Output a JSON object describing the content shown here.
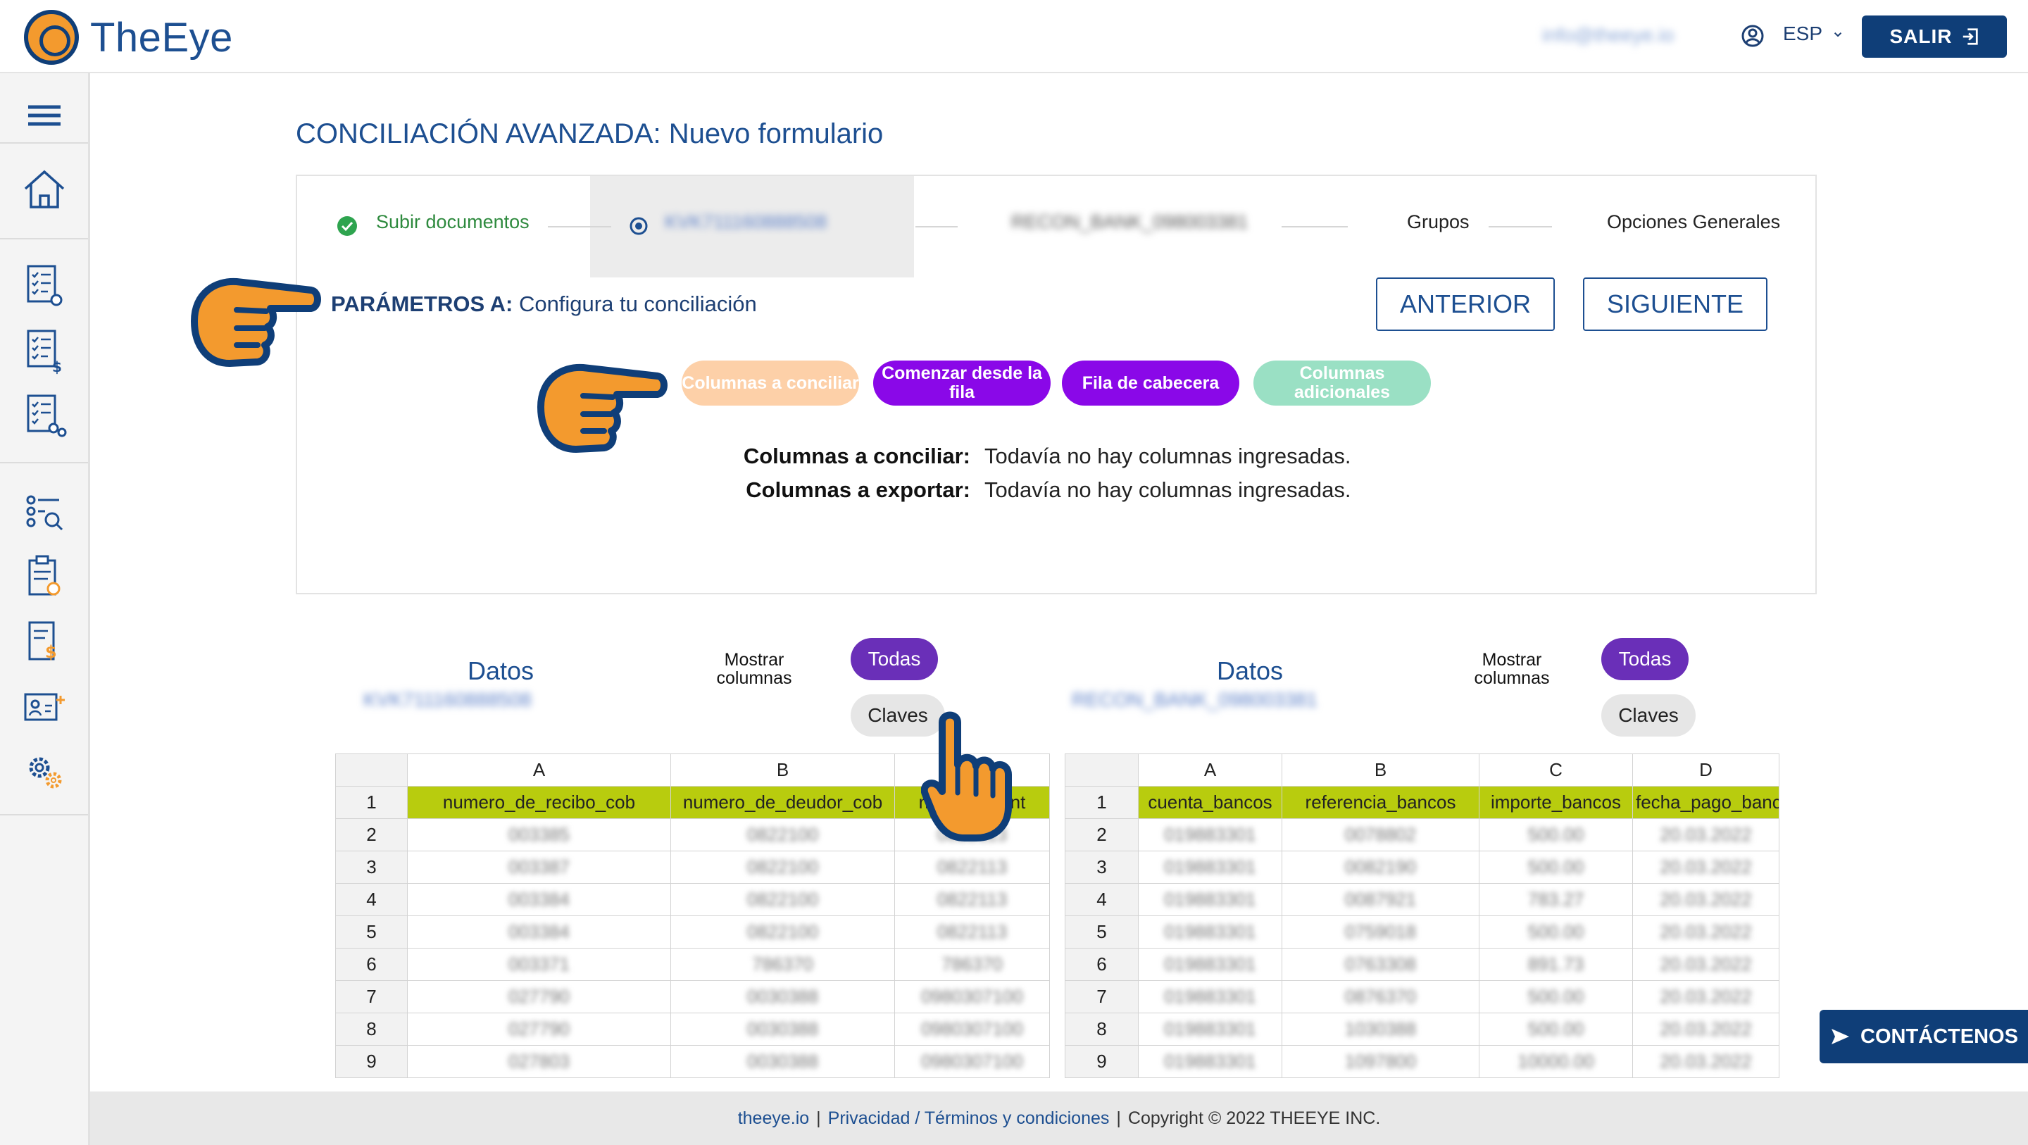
{
  "app": {
    "name": "TheEye",
    "user_email": "info@theeye.io",
    "language": "ESP",
    "logout_label": "SALIR"
  },
  "page": {
    "title": "CONCILIACIÓN AVANZADA:  Nuevo formulario"
  },
  "steps": [
    {
      "label": "Subir documentos",
      "state": "done"
    },
    {
      "label": "KVK711160888508",
      "state": "active"
    },
    {
      "label": "RECON_BANK_098003381",
      "state": "pending"
    },
    {
      "label": "Grupos",
      "state": "pending"
    },
    {
      "label": "Opciones Generales",
      "state": "pending"
    }
  ],
  "params": {
    "prefix": "PARÁMETROS A:",
    "text": " Configura tu conciliación",
    "prev_label": "ANTERIOR",
    "next_label": "SIGUIENTE"
  },
  "pills": [
    {
      "label": "Columnas a conciliar",
      "color": "#fdd0a8"
    },
    {
      "label": "Comenzar desde la fila",
      "color": "#8a08e8"
    },
    {
      "label": "Fila de cabecera",
      "color": "#8a08e8"
    },
    {
      "label": "Columnas adicionales",
      "color": "#9ae0c4"
    }
  ],
  "info": {
    "conciliar_label": "Columnas a conciliar:",
    "conciliar_value": "Todavía no hay columnas ingresadas.",
    "exportar_label": "Columnas a exportar:",
    "exportar_value": "Todavía no hay columnas ingresadas."
  },
  "panels": [
    {
      "title": "Datos",
      "source": "KVK711160888508",
      "mostrar_label": "Mostrar columnas",
      "todas_label": "Todas",
      "claves_label": "Claves",
      "col_letters": [
        "A",
        "B",
        "C"
      ],
      "headers": [
        "numero_de_recibo_cob",
        "numero_de_deudor_cob",
        "numero_cont"
      ],
      "rows": [
        [
          "",
          "",
          ""
        ],
        [
          "003385",
          "0822100",
          "0822113"
        ],
        [
          "003387",
          "0822100",
          "0822113"
        ],
        [
          "003384",
          "0822100",
          "0822113"
        ],
        [
          "003384",
          "0822100",
          "0822113"
        ],
        [
          "003371",
          "786370",
          "786370"
        ],
        [
          "027790",
          "0030388",
          "0980307100"
        ],
        [
          "027790",
          "0030388",
          "0980307100"
        ],
        [
          "027803",
          "0030388",
          "0980307100"
        ]
      ]
    },
    {
      "title": "Datos",
      "source": "RECON_BANK_098003381",
      "mostrar_label": "Mostrar columnas",
      "todas_label": "Todas",
      "claves_label": "Claves",
      "col_letters": [
        "A",
        "B",
        "C",
        "D"
      ],
      "headers": [
        "cuenta_bancos",
        "referencia_bancos",
        "importe_bancos",
        "fecha_pago_bancos"
      ],
      "rows": [
        [
          "",
          "",
          "",
          ""
        ],
        [
          "019883301",
          "0078802",
          "500.00",
          "20.03.2022"
        ],
        [
          "019883301",
          "0082190",
          "500.00",
          "20.03.2022"
        ],
        [
          "019883301",
          "0087921",
          "783.27",
          "20.03.2022"
        ],
        [
          "019883301",
          "0759018",
          "500.00",
          "20.03.2022"
        ],
        [
          "019883301",
          "0763308",
          "891.73",
          "20.03.2022"
        ],
        [
          "019883301",
          "0876370",
          "500.00",
          "20.03.2022"
        ],
        [
          "019883301",
          "1030388",
          "500.00",
          "20.03.2022"
        ],
        [
          "019883301",
          "1097800",
          "10000.00",
          "20.03.2022"
        ]
      ]
    }
  ],
  "footer": {
    "site": "theeye.io",
    "sep1": "|",
    "privacy": "Privacidad / Términos y condiciones",
    "sep2": "|",
    "copyright": "Copyright © 2022 THEEYE INC."
  },
  "contact_label": "CONTÁCTENOS",
  "colors": {
    "brand_blue": "#0f3e78",
    "brand_orange": "#f39a2e",
    "pill_purple": "#8a08e8",
    "header_green": "#b8cc0e"
  }
}
